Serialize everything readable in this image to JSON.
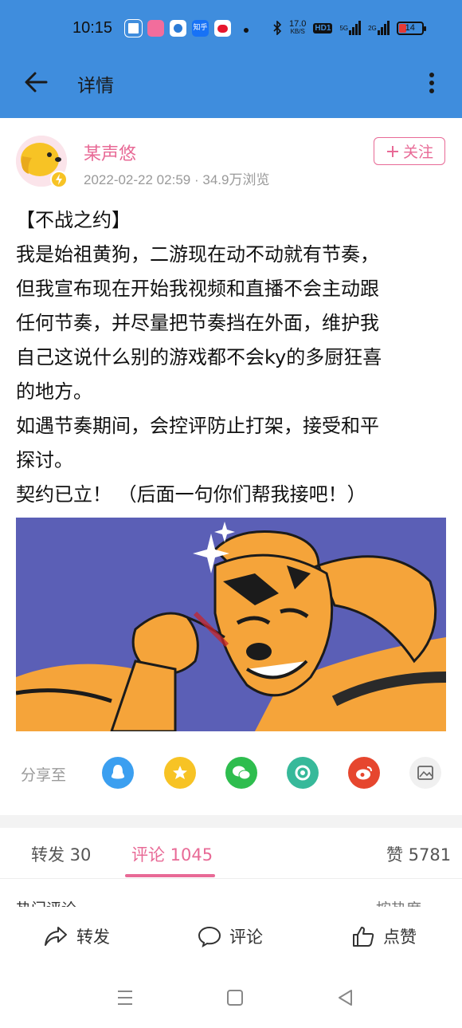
{
  "status_bar": {
    "time": "10:15",
    "net_speed_value": "17.0",
    "net_speed_unit": "KB/S",
    "hd_label": "HD1",
    "sim1_label": "5G",
    "sim2_label": "2G",
    "battery": "14",
    "app_icons": [
      "qq-browser-icon",
      "bilibili-icon",
      "app-circle-icon",
      "zhihu-icon",
      "weibo-icon"
    ],
    "zhihu_label": "知乎"
  },
  "appbar": {
    "title": "详情"
  },
  "post": {
    "username": "某声悠",
    "timestamp": "2022-02-22 02:59",
    "views": "34.9万浏览",
    "follow_label": "关注",
    "lines": [
      "【不战之约】",
      "我是始祖黄狗，二游现在动不动就有节奏，",
      "但我宣布现在开始我视频和直播不会主动跟",
      "任何节奏，并尽量把节奏挡在外面，维护我",
      "自己这说什么别的游戏都不会ky的多厨狂喜",
      "的地方。",
      "如遇节奏期间，会控评防止打架，接受和平",
      "探讨。",
      "契约已立！ （后面一句你们帮我接吧！）"
    ]
  },
  "share": {
    "label": "分享至",
    "targets": [
      "qq-icon",
      "qzone-icon",
      "wechat-icon",
      "moments-icon",
      "weibo-icon",
      "image-icon"
    ]
  },
  "tabs": {
    "repost": "转发 30",
    "comments": "评论 1045",
    "likes": "赞 5781"
  },
  "comments_peek": {
    "left": "热门评论",
    "right": "按热度"
  },
  "actions": {
    "repost": "转发",
    "comment": "评论",
    "like": "点赞"
  },
  "colors": {
    "topbar": "#3f8ddd",
    "accent": "#e86a96",
    "image_bg": "#5b5fb6",
    "dog_orange": "#f5a43a"
  }
}
